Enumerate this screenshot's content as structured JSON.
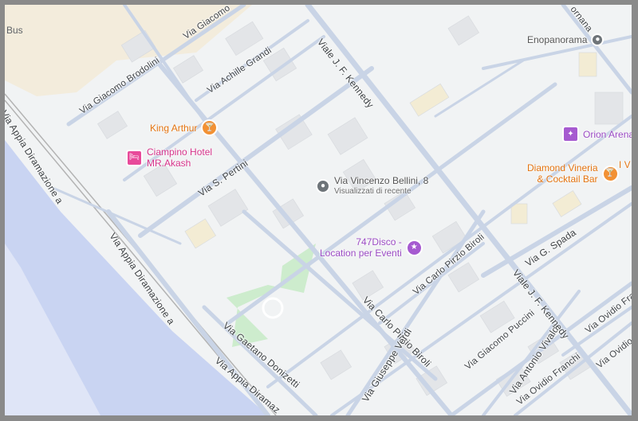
{
  "map": {
    "colors": {
      "land": "#f1f3f4",
      "sand": "#f3ecdc",
      "water": "#c9d4f2",
      "road": "#c9d4e6",
      "building": "#e3e5e8",
      "park": "#cdeccd",
      "rail": "#b9b9b9"
    },
    "places": [
      {
        "name": "Bus",
        "kind": "label"
      },
      {
        "name": "King Arthur",
        "kind": "food",
        "icon": "cocktail-icon"
      },
      {
        "name": "Ciampino Hotel",
        "name2": "MR.Akash",
        "kind": "hotel",
        "icon": "hotel-bed-icon"
      },
      {
        "name": "Via Vincenzo Bellini, 8",
        "sub": "Visualizzati di recente",
        "kind": "gen",
        "icon": "location-pin-icon"
      },
      {
        "name": "747Disco -",
        "name2": "Location per Eventi",
        "kind": "ent",
        "icon": "disco-ball-icon"
      },
      {
        "name": "Enopanorama",
        "kind": "gen",
        "icon": "location-pin-icon"
      },
      {
        "name": "Orion Arena",
        "kind": "ent",
        "icon": "arena-icon"
      },
      {
        "name": "Diamond Vineria",
        "name2": "& Cocktail Bar",
        "kind": "food",
        "icon": "cocktail-icon"
      },
      {
        "name": "I V",
        "kind": "label"
      }
    ],
    "roads": [
      "Via Giacomo Brodolini",
      "Via Achille Grandi",
      "Via Giacomo",
      "Viale J. F. Kennedy",
      "Via S. Pertini",
      "Via Appia Diramazione a",
      "Via Appia Diramazione a",
      "Via Gaetano Donizetti",
      "Via Appia Diramaz",
      "Via Carlo Pirzio Biroli",
      "Via Carlo Pirzio Biroli",
      "Via Giuseppe Verdi",
      "Via Giacomo Puccini",
      "Via Antonio Vivaldi",
      "Viale J. F. Kennedy",
      "Via G. Spada",
      "Via Ovidio Franchi",
      "Via Ovidio Franchi",
      "Via Ovidio Franchi",
      "ornana"
    ]
  }
}
